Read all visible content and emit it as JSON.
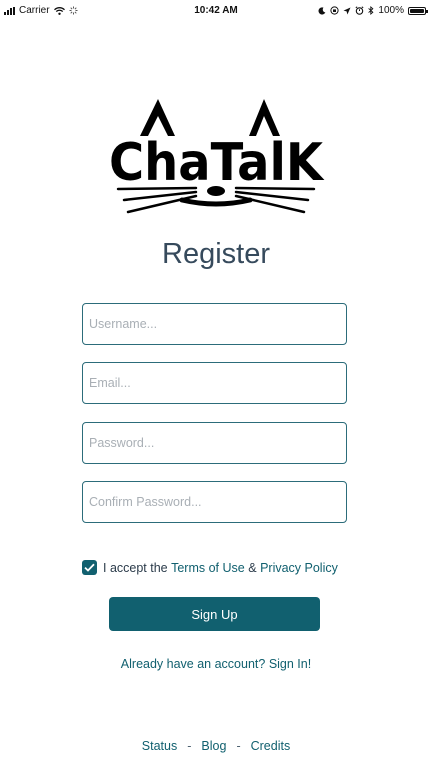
{
  "status_bar": {
    "carrier": "Carrier",
    "time": "10:42 AM",
    "battery": "100%"
  },
  "logo": {
    "text": "ChaTalK"
  },
  "form": {
    "title": "Register",
    "username_placeholder": "Username...",
    "email_placeholder": "Email...",
    "password_placeholder": "Password...",
    "confirm_password_placeholder": "Confirm Password...",
    "terms_prefix": "I accept the",
    "terms_link": "Terms of Use",
    "terms_and": "&",
    "privacy_link": "Privacy Policy",
    "terms_checked": true,
    "signup_label": "Sign Up",
    "signin_link": "Already have an account? Sign In!"
  },
  "footer": {
    "status": "Status",
    "blog": "Blog",
    "credits": "Credits",
    "separator": "-"
  },
  "colors": {
    "accent": "#11606f",
    "title": "#364a5c",
    "input_border": "#2c6c7a"
  }
}
